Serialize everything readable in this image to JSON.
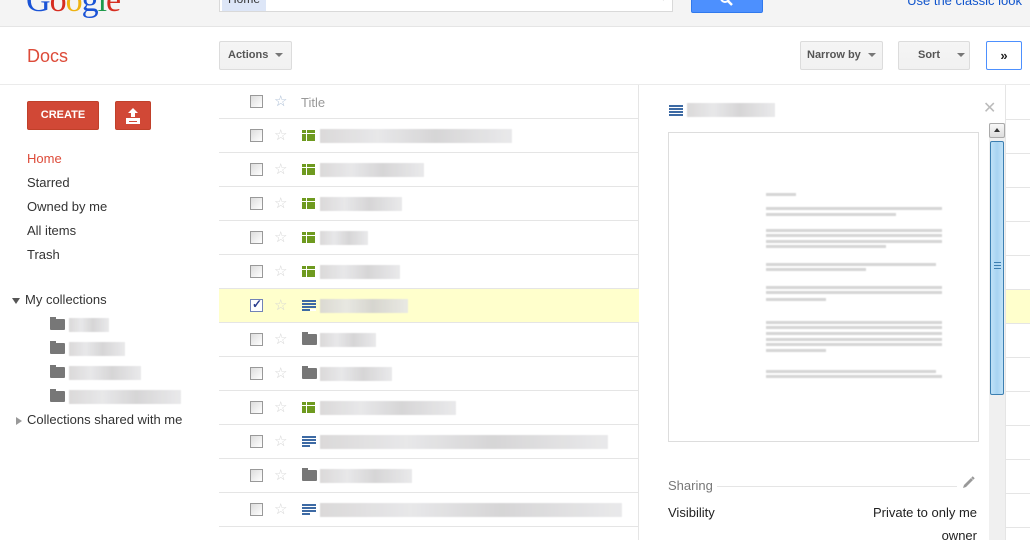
{
  "topbar": {
    "logo_letters": [
      "G",
      "o",
      "o",
      "g",
      "l",
      "e"
    ],
    "search_chip": "Home",
    "search_placeholder": "",
    "search_button_icon": "search-icon",
    "classic_link": "Use the classic look"
  },
  "subbar": {
    "app_title": "Docs",
    "actions_label": "Actions",
    "narrow_label": "Narrow by",
    "sort_label": "Sort",
    "expand_label": "»"
  },
  "sidebar": {
    "create_label": "CREATE",
    "upload_icon": "upload-icon",
    "nav": [
      {
        "label": "Home",
        "active": true
      },
      {
        "label": "Starred",
        "active": false
      },
      {
        "label": "Owned by me",
        "active": false
      },
      {
        "label": "All items",
        "active": false
      },
      {
        "label": "Trash",
        "active": false
      }
    ],
    "my_collections_label": "My collections",
    "collections": [
      {
        "name": "[redacted]",
        "icon": "folder-icon"
      },
      {
        "name": "[redacted]",
        "icon": "folder-icon"
      },
      {
        "name": "[redacted]",
        "icon": "folder-icon"
      },
      {
        "name": "[redacted]",
        "icon": "folder-icon"
      }
    ],
    "shared_label": "Collections shared with me"
  },
  "list": {
    "title_header": "Title",
    "rows": [
      {
        "type": "spreadsheet",
        "title": "[redacted]",
        "checked": false,
        "selected": false
      },
      {
        "type": "spreadsheet",
        "title": "[redacted]",
        "checked": false,
        "selected": false
      },
      {
        "type": "spreadsheet",
        "title": "[redacted]",
        "checked": false,
        "selected": false
      },
      {
        "type": "spreadsheet",
        "title": "[redacted]",
        "checked": false,
        "selected": false
      },
      {
        "type": "spreadsheet",
        "title": "[redacted]",
        "checked": false,
        "selected": false
      },
      {
        "type": "document",
        "title": "[redacted]",
        "checked": true,
        "selected": true
      },
      {
        "type": "folder",
        "title": "[redacted]",
        "checked": false,
        "selected": false
      },
      {
        "type": "folder",
        "title": "[redacted]",
        "checked": false,
        "selected": false
      },
      {
        "type": "spreadsheet",
        "title": "[redacted]",
        "checked": false,
        "selected": false
      },
      {
        "type": "document",
        "title": "[redacted]",
        "checked": false,
        "selected": false
      },
      {
        "type": "folder",
        "title": "[redacted]",
        "checked": false,
        "selected": false
      },
      {
        "type": "document",
        "title": "[redacted]",
        "checked": false,
        "selected": false
      }
    ]
  },
  "preview": {
    "title": "[redacted]",
    "close_icon": "close-icon",
    "sharing_label": "Sharing",
    "visibility_label": "Visibility",
    "visibility_value": "Private to only me",
    "owner_label": "owner"
  },
  "colors": {
    "accent_red": "#dd4b39",
    "create_red": "#d14836",
    "search_blue": "#4d90fe",
    "selected_row": "#ffffcc",
    "sheet_green": "#6e9a1f",
    "doc_blue": "#3d6aa4"
  }
}
